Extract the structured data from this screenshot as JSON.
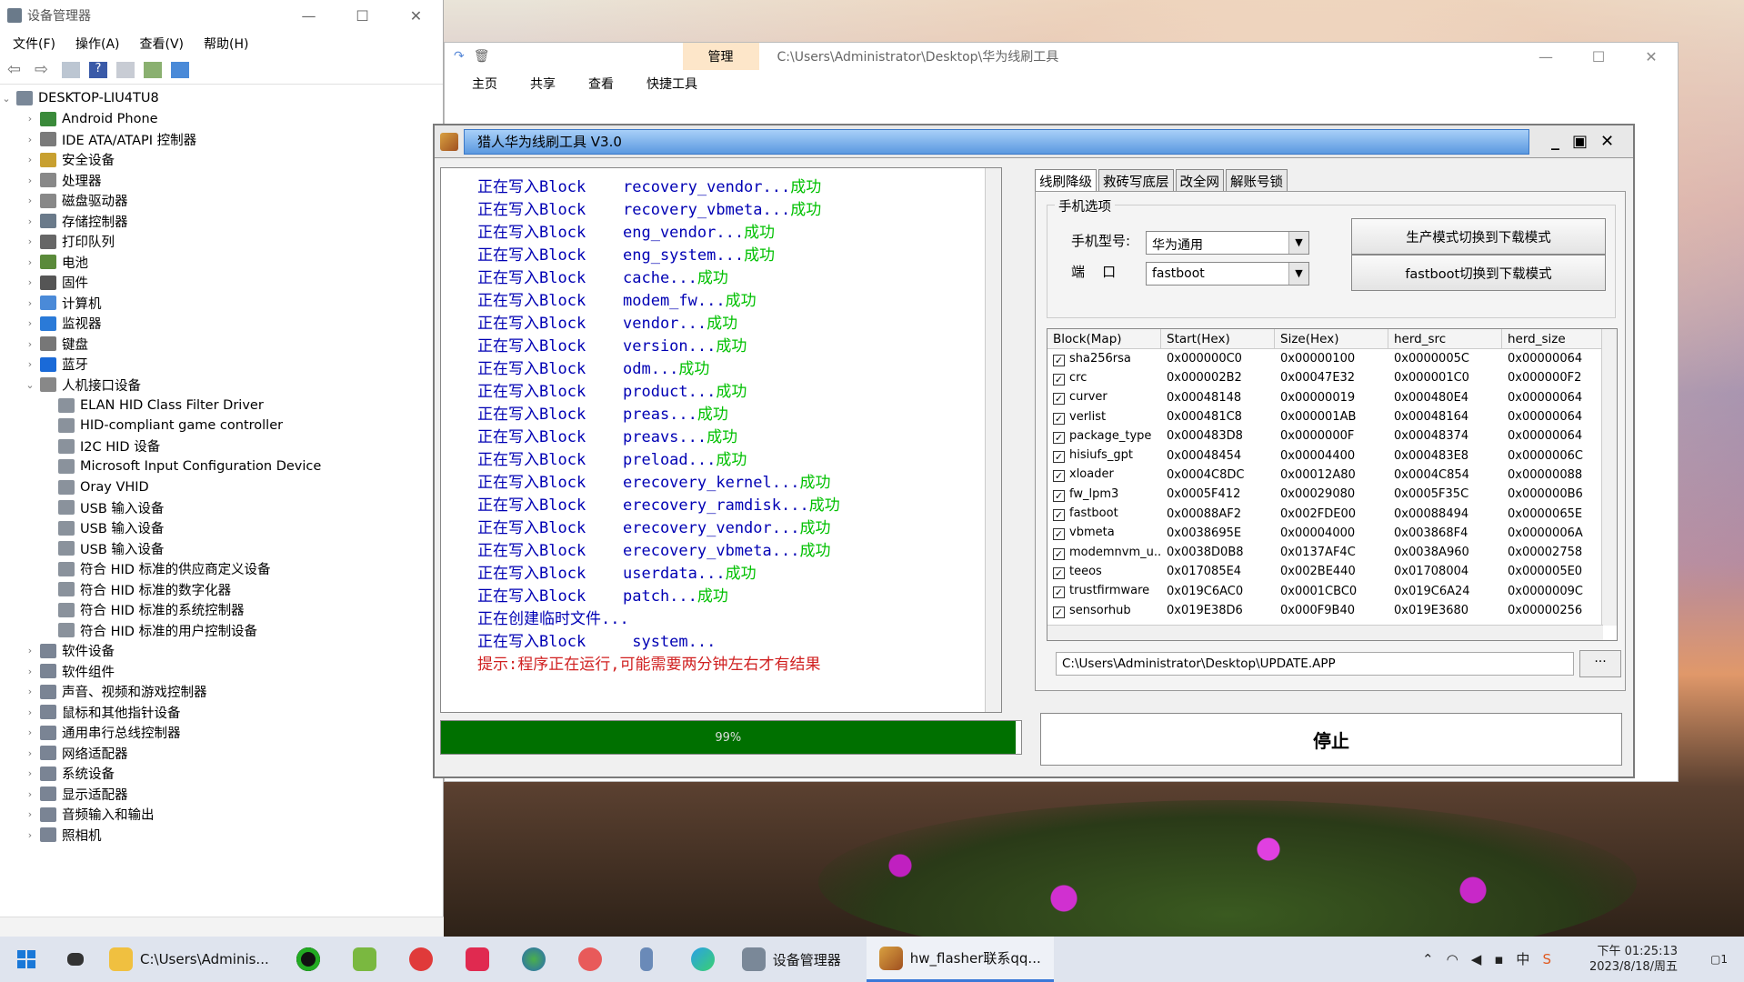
{
  "device_manager": {
    "title": "设备管理器",
    "menu": [
      "文件(F)",
      "操作(A)",
      "查看(V)",
      "帮助(H)"
    ],
    "root": "DESKTOP-LIU4TU8",
    "categories": [
      "Android Phone",
      "IDE ATA/ATAPI 控制器",
      "安全设备",
      "处理器",
      "磁盘驱动器",
      "存储控制器",
      "打印队列",
      "电池",
      "固件",
      "计算机",
      "监视器",
      "键盘",
      "蓝牙",
      "人机接口设备"
    ],
    "hid_children": [
      "ELAN HID Class Filter Driver",
      "HID-compliant game controller",
      "I2C HID 设备",
      "Microsoft Input Configuration Device",
      "Oray VHID",
      "USB 输入设备",
      "USB 输入设备",
      "USB 输入设备",
      "符合 HID 标准的供应商定义设备",
      "符合 HID 标准的数字化器",
      "符合 HID 标准的系统控制器",
      "符合 HID 标准的用户控制设备"
    ],
    "more_categories": [
      "软件设备",
      "软件组件",
      "声音、视频和游戏控制器",
      "鼠标和其他指针设备",
      "通用串行总线控制器",
      "网络适配器",
      "系统设备",
      "显示适配器",
      "音频输入和输出",
      "照相机"
    ]
  },
  "explorer": {
    "tab_manage": "管理",
    "path": "C:\\Users\\Administrator\\Desktop\\华为线刷工具",
    "ribbon": [
      "主页",
      "共享",
      "查看",
      "快捷工具"
    ]
  },
  "flasher": {
    "title": "猎人华为线刷工具 V3.0",
    "log_prefix": "正在写入Block",
    "log": [
      {
        "block": "recovery_vendor...",
        "ok": "成功"
      },
      {
        "block": "recovery_vbmeta...",
        "ok": "成功"
      },
      {
        "block": "eng_vendor...",
        "ok": "成功"
      },
      {
        "block": "eng_system...",
        "ok": "成功"
      },
      {
        "block": "cache...",
        "ok": "成功"
      },
      {
        "block": "modem_fw...",
        "ok": "成功"
      },
      {
        "block": "vendor...",
        "ok": "成功"
      },
      {
        "block": "version...",
        "ok": "成功"
      },
      {
        "block": "odm...",
        "ok": "成功"
      },
      {
        "block": "product...",
        "ok": "成功"
      },
      {
        "block": "preas...",
        "ok": "成功"
      },
      {
        "block": "preavs...",
        "ok": "成功"
      },
      {
        "block": "preload...",
        "ok": "成功"
      },
      {
        "block": "erecovery_kernel...",
        "ok": "成功"
      },
      {
        "block": "erecovery_ramdisk...",
        "ok": "成功"
      },
      {
        "block": "erecovery_vendor...",
        "ok": "成功"
      },
      {
        "block": "erecovery_vbmeta...",
        "ok": "成功"
      },
      {
        "block": "userdata...",
        "ok": "成功"
      },
      {
        "block": "patch...",
        "ok": "成功"
      }
    ],
    "creating_temp": "正在创建临时文件...",
    "last_block": " system...",
    "warning": "提示:程序正在运行,可能需要两分钟左右才有结果",
    "progress_label": "99%",
    "progress_value": 0.99,
    "tabs": [
      "线刷降级",
      "救砖写底层",
      "改全网",
      "解账号锁"
    ],
    "group_label": "手机选项",
    "model_label": "手机型号:",
    "model_value": "华为通用",
    "port_label": "端    口",
    "port_value": "fastboot",
    "btn_prod": "生产模式切换到下载模式",
    "btn_fastboot": "fastboot切换到下载模式",
    "columns": [
      "Block(Map)",
      "Start(Hex)",
      "Size(Hex)",
      "herd_src",
      "herd_size"
    ],
    "rows": [
      [
        "sha256rsa",
        "0x000000C0",
        "0x00000100",
        "0x0000005C",
        "0x00000064"
      ],
      [
        "crc",
        "0x000002B2",
        "0x00047E32",
        "0x000001C0",
        "0x000000F2"
      ],
      [
        "curver",
        "0x00048148",
        "0x00000019",
        "0x000480E4",
        "0x00000064"
      ],
      [
        "verlist",
        "0x000481C8",
        "0x000001AB",
        "0x00048164",
        "0x00000064"
      ],
      [
        "package_type",
        "0x000483D8",
        "0x0000000F",
        "0x00048374",
        "0x00000064"
      ],
      [
        "hisiufs_gpt",
        "0x00048454",
        "0x00004400",
        "0x000483E8",
        "0x0000006C"
      ],
      [
        "xloader",
        "0x0004C8DC",
        "0x00012A80",
        "0x0004C854",
        "0x00000088"
      ],
      [
        "fw_lpm3",
        "0x0005F412",
        "0x00029080",
        "0x0005F35C",
        "0x000000B6"
      ],
      [
        "fastboot",
        "0x00088AF2",
        "0x002FDE00",
        "0x00088494",
        "0x0000065E"
      ],
      [
        "vbmeta",
        "0x0038695E",
        "0x00004000",
        "0x003868F4",
        "0x0000006A"
      ],
      [
        "modemnvm_u...",
        "0x0038D0B8",
        "0x0137AF4C",
        "0x0038A960",
        "0x00002758"
      ],
      [
        "teeos",
        "0x017085E4",
        "0x002BE440",
        "0x01708004",
        "0x000005E0"
      ],
      [
        "trustfirmware",
        "0x019C6AC0",
        "0x0001CBC0",
        "0x019C6A24",
        "0x0000009C"
      ],
      [
        "sensorhub",
        "0x019E38D6",
        "0x000F9B40",
        "0x019E3680",
        "0x00000256"
      ]
    ],
    "file_path": "C:\\Users\\Administrator\\Desktop\\UPDATE.APP",
    "browse": "...",
    "stop": "停止"
  },
  "taskbar": {
    "explorer_label": "C:\\Users\\Adminis...",
    "devmgr_label": "设备管理器",
    "flasher_label": "hw_flasher联系qq...",
    "ime": "中",
    "time": "下午 01:25:13",
    "date": "2023/8/18/周五",
    "notif": "1"
  }
}
